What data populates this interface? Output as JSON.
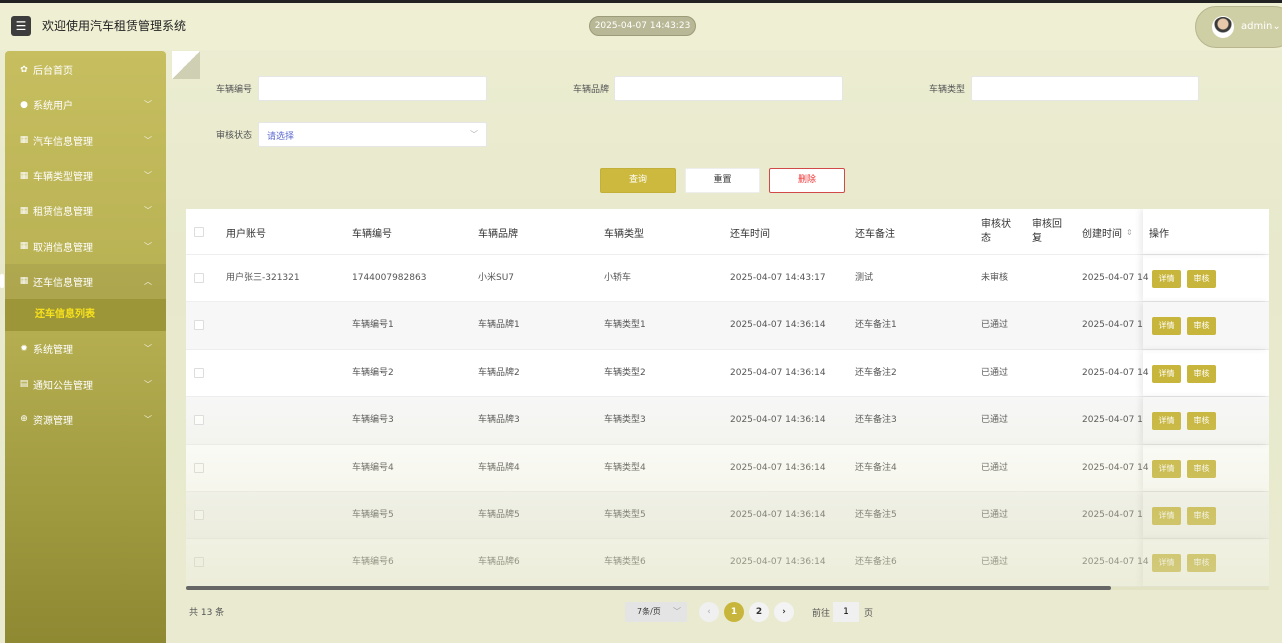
{
  "header": {
    "menu_icon": "hamburger-icon",
    "title": "欢迎使用汽车租赁管理系统",
    "clock": "2025-04-07 14:43:23",
    "user": "admin"
  },
  "sidebar": {
    "items": [
      {
        "label": "后台首页",
        "icon": "home-icon"
      },
      {
        "label": "系统用户",
        "icon": "user-icon"
      },
      {
        "label": "汽车信息管理",
        "icon": "grid-icon"
      },
      {
        "label": "车辆类型管理",
        "icon": "grid-icon"
      },
      {
        "label": "租赁信息管理",
        "icon": "grid-icon"
      },
      {
        "label": "取消信息管理",
        "icon": "grid-icon"
      },
      {
        "label": "还车信息管理",
        "icon": "grid-icon"
      },
      {
        "label": "系统管理",
        "icon": "gear-icon"
      },
      {
        "label": "通知公告管理",
        "icon": "document-icon"
      },
      {
        "label": "资源管理",
        "icon": "plus-circle-icon"
      }
    ],
    "active_sub": "还车信息列表"
  },
  "filters": {
    "vehicle_no_label": "车辆编号",
    "brand_label": "车辆品牌",
    "type_label": "车辆类型",
    "status_label": "审核状态",
    "status_placeholder": "请选择",
    "vehicle_no_value": "",
    "brand_value": "",
    "type_value": ""
  },
  "buttons": {
    "search": "查询",
    "reset": "重置",
    "delete": "删除"
  },
  "table": {
    "columns": [
      "用户账号",
      "车辆编号",
      "车辆品牌",
      "车辆类型",
      "还车时间",
      "还车备注",
      "审核状态",
      "审核回复",
      "创建时间",
      "操作"
    ],
    "rows": [
      [
        "用户张三-321321",
        "1744007982863",
        "小米SU7",
        "小轿车",
        "2025-04-07 14:43:17",
        "测试",
        "未审核",
        "",
        "2025-04-07 14"
      ],
      [
        "",
        "车辆编号1",
        "车辆品牌1",
        "车辆类型1",
        "2025-04-07 14:36:14",
        "还车备注1",
        "已通过",
        "",
        "2025-04-07 14"
      ],
      [
        "",
        "车辆编号2",
        "车辆品牌2",
        "车辆类型2",
        "2025-04-07 14:36:14",
        "还车备注2",
        "已通过",
        "",
        "2025-04-07 14"
      ],
      [
        "",
        "车辆编号3",
        "车辆品牌3",
        "车辆类型3",
        "2025-04-07 14:36:14",
        "还车备注3",
        "已通过",
        "",
        "2025-04-07 14"
      ],
      [
        "",
        "车辆编号4",
        "车辆品牌4",
        "车辆类型4",
        "2025-04-07 14:36:14",
        "还车备注4",
        "已通过",
        "",
        "2025-04-07 14"
      ],
      [
        "",
        "车辆编号5",
        "车辆品牌5",
        "车辆类型5",
        "2025-04-07 14:36:14",
        "还车备注5",
        "已通过",
        "",
        "2025-04-07 14"
      ],
      [
        "",
        "车辆编号6",
        "车辆品牌6",
        "车辆类型6",
        "2025-04-07 14:36:14",
        "还车备注6",
        "已通过",
        "",
        "2025-04-07 14"
      ]
    ],
    "detail_btn": "详情",
    "review_btn": "审核"
  },
  "pagination": {
    "total": "共 13 条",
    "page_size": "7条/页",
    "pages": [
      "1",
      "2"
    ],
    "current": "1",
    "goto_prefix": "前往",
    "goto_value": "1",
    "goto_suffix": "页"
  },
  "colors": {
    "accent": "#c8b63c",
    "sidebar": "#bdb556",
    "active_sub_text": "#f7e11c",
    "delete": "#e33333"
  }
}
